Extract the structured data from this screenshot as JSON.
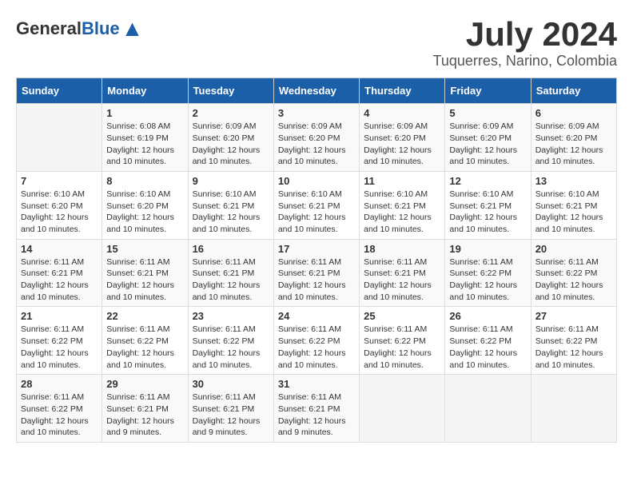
{
  "header": {
    "logo_general": "General",
    "logo_blue": "Blue",
    "title": "July 2024",
    "location": "Tuquerres, Narino, Colombia"
  },
  "columns": [
    "Sunday",
    "Monday",
    "Tuesday",
    "Wednesday",
    "Thursday",
    "Friday",
    "Saturday"
  ],
  "weeks": [
    [
      {
        "day": "",
        "info": ""
      },
      {
        "day": "1",
        "info": "Sunrise: 6:08 AM\nSunset: 6:19 PM\nDaylight: 12 hours and 10 minutes."
      },
      {
        "day": "2",
        "info": "Sunrise: 6:09 AM\nSunset: 6:20 PM\nDaylight: 12 hours and 10 minutes."
      },
      {
        "day": "3",
        "info": "Sunrise: 6:09 AM\nSunset: 6:20 PM\nDaylight: 12 hours and 10 minutes."
      },
      {
        "day": "4",
        "info": "Sunrise: 6:09 AM\nSunset: 6:20 PM\nDaylight: 12 hours and 10 minutes."
      },
      {
        "day": "5",
        "info": "Sunrise: 6:09 AM\nSunset: 6:20 PM\nDaylight: 12 hours and 10 minutes."
      },
      {
        "day": "6",
        "info": "Sunrise: 6:09 AM\nSunset: 6:20 PM\nDaylight: 12 hours and 10 minutes."
      }
    ],
    [
      {
        "day": "7",
        "info": "Sunrise: 6:10 AM\nSunset: 6:20 PM\nDaylight: 12 hours and 10 minutes."
      },
      {
        "day": "8",
        "info": "Sunrise: 6:10 AM\nSunset: 6:20 PM\nDaylight: 12 hours and 10 minutes."
      },
      {
        "day": "9",
        "info": "Sunrise: 6:10 AM\nSunset: 6:21 PM\nDaylight: 12 hours and 10 minutes."
      },
      {
        "day": "10",
        "info": "Sunrise: 6:10 AM\nSunset: 6:21 PM\nDaylight: 12 hours and 10 minutes."
      },
      {
        "day": "11",
        "info": "Sunrise: 6:10 AM\nSunset: 6:21 PM\nDaylight: 12 hours and 10 minutes."
      },
      {
        "day": "12",
        "info": "Sunrise: 6:10 AM\nSunset: 6:21 PM\nDaylight: 12 hours and 10 minutes."
      },
      {
        "day": "13",
        "info": "Sunrise: 6:10 AM\nSunset: 6:21 PM\nDaylight: 12 hours and 10 minutes."
      }
    ],
    [
      {
        "day": "14",
        "info": "Sunrise: 6:11 AM\nSunset: 6:21 PM\nDaylight: 12 hours and 10 minutes."
      },
      {
        "day": "15",
        "info": "Sunrise: 6:11 AM\nSunset: 6:21 PM\nDaylight: 12 hours and 10 minutes."
      },
      {
        "day": "16",
        "info": "Sunrise: 6:11 AM\nSunset: 6:21 PM\nDaylight: 12 hours and 10 minutes."
      },
      {
        "day": "17",
        "info": "Sunrise: 6:11 AM\nSunset: 6:21 PM\nDaylight: 12 hours and 10 minutes."
      },
      {
        "day": "18",
        "info": "Sunrise: 6:11 AM\nSunset: 6:21 PM\nDaylight: 12 hours and 10 minutes."
      },
      {
        "day": "19",
        "info": "Sunrise: 6:11 AM\nSunset: 6:22 PM\nDaylight: 12 hours and 10 minutes."
      },
      {
        "day": "20",
        "info": "Sunrise: 6:11 AM\nSunset: 6:22 PM\nDaylight: 12 hours and 10 minutes."
      }
    ],
    [
      {
        "day": "21",
        "info": "Sunrise: 6:11 AM\nSunset: 6:22 PM\nDaylight: 12 hours and 10 minutes."
      },
      {
        "day": "22",
        "info": "Sunrise: 6:11 AM\nSunset: 6:22 PM\nDaylight: 12 hours and 10 minutes."
      },
      {
        "day": "23",
        "info": "Sunrise: 6:11 AM\nSunset: 6:22 PM\nDaylight: 12 hours and 10 minutes."
      },
      {
        "day": "24",
        "info": "Sunrise: 6:11 AM\nSunset: 6:22 PM\nDaylight: 12 hours and 10 minutes."
      },
      {
        "day": "25",
        "info": "Sunrise: 6:11 AM\nSunset: 6:22 PM\nDaylight: 12 hours and 10 minutes."
      },
      {
        "day": "26",
        "info": "Sunrise: 6:11 AM\nSunset: 6:22 PM\nDaylight: 12 hours and 10 minutes."
      },
      {
        "day": "27",
        "info": "Sunrise: 6:11 AM\nSunset: 6:22 PM\nDaylight: 12 hours and 10 minutes."
      }
    ],
    [
      {
        "day": "28",
        "info": "Sunrise: 6:11 AM\nSunset: 6:22 PM\nDaylight: 12 hours and 10 minutes."
      },
      {
        "day": "29",
        "info": "Sunrise: 6:11 AM\nSunset: 6:21 PM\nDaylight: 12 hours and 9 minutes."
      },
      {
        "day": "30",
        "info": "Sunrise: 6:11 AM\nSunset: 6:21 PM\nDaylight: 12 hours and 9 minutes."
      },
      {
        "day": "31",
        "info": "Sunrise: 6:11 AM\nSunset: 6:21 PM\nDaylight: 12 hours and 9 minutes."
      },
      {
        "day": "",
        "info": ""
      },
      {
        "day": "",
        "info": ""
      },
      {
        "day": "",
        "info": ""
      }
    ]
  ]
}
